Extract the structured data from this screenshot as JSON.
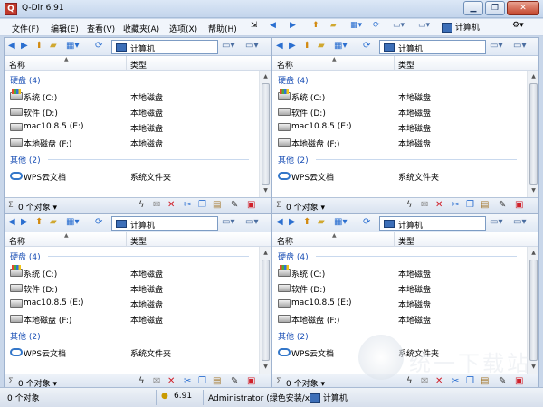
{
  "window": {
    "title": "Q-Dir 6.91",
    "controls": [
      "minimize",
      "restore",
      "close"
    ]
  },
  "menu": {
    "items": [
      "文件(F)",
      "编辑(E)",
      "查看(V)",
      "收藏夹(A)",
      "选项(X)",
      "帮助(H)"
    ],
    "right_label": "计算机"
  },
  "panes": [
    {
      "path": "计算机",
      "columns": {
        "name": "名称",
        "type": "类型"
      },
      "groups": [
        {
          "header": "硬盘 (4)",
          "items": [
            {
              "name": "系统 (C:)",
              "type": "本地磁盘",
              "icon": "system-drive-icon"
            },
            {
              "name": "软件 (D:)",
              "type": "本地磁盘",
              "icon": "drive-icon"
            },
            {
              "name": "mac10.8.5 (E:)",
              "type": "本地磁盘",
              "icon": "drive-icon"
            },
            {
              "name": "本地磁盘 (F:)",
              "type": "本地磁盘",
              "icon": "drive-icon"
            }
          ]
        },
        {
          "header": "其他 (2)",
          "items": [
            {
              "name": "WPS云文档",
              "type": "系统文件夹",
              "icon": "cloud-icon"
            }
          ]
        }
      ],
      "status": "0 个对象"
    },
    {
      "path": "计算机",
      "columns": {
        "name": "名称",
        "type": "类型"
      },
      "groups": [
        {
          "header": "硬盘 (4)",
          "items": [
            {
              "name": "系统 (C:)",
              "type": "本地磁盘",
              "icon": "system-drive-icon"
            },
            {
              "name": "软件 (D:)",
              "type": "本地磁盘",
              "icon": "drive-icon"
            },
            {
              "name": "mac10.8.5 (E:)",
              "type": "本地磁盘",
              "icon": "drive-icon"
            },
            {
              "name": "本地磁盘 (F:)",
              "type": "本地磁盘",
              "icon": "drive-icon"
            }
          ]
        },
        {
          "header": "其他 (2)",
          "items": [
            {
              "name": "WPS云文档",
              "type": "系统文件夹",
              "icon": "cloud-icon"
            }
          ]
        }
      ],
      "status": "0 个对象"
    },
    {
      "path": "计算机",
      "columns": {
        "name": "名称",
        "type": "类型"
      },
      "groups": [
        {
          "header": "硬盘 (4)",
          "items": [
            {
              "name": "系统 (C:)",
              "type": "本地磁盘",
              "icon": "system-drive-icon"
            },
            {
              "name": "软件 (D:)",
              "type": "本地磁盘",
              "icon": "drive-icon"
            },
            {
              "name": "mac10.8.5 (E:)",
              "type": "本地磁盘",
              "icon": "drive-icon"
            },
            {
              "name": "本地磁盘 (F:)",
              "type": "本地磁盘",
              "icon": "drive-icon"
            }
          ]
        },
        {
          "header": "其他 (2)",
          "items": [
            {
              "name": "WPS云文档",
              "type": "系统文件夹",
              "icon": "cloud-icon"
            }
          ]
        }
      ],
      "status": "0 个对象"
    },
    {
      "path": "计算机",
      "columns": {
        "name": "名称",
        "type": "类型"
      },
      "groups": [
        {
          "header": "硬盘 (4)",
          "items": [
            {
              "name": "系统 (C:)",
              "type": "本地磁盘",
              "icon": "system-drive-icon"
            },
            {
              "name": "软件 (D:)",
              "type": "本地磁盘",
              "icon": "drive-icon"
            },
            {
              "name": "mac10.8.5 (E:)",
              "type": "本地磁盘",
              "icon": "drive-icon"
            },
            {
              "name": "本地磁盘 (F:)",
              "type": "本地磁盘",
              "icon": "drive-icon"
            }
          ]
        },
        {
          "header": "其他 (2)",
          "items": [
            {
              "name": "WPS云文档",
              "type": "系统文件夹",
              "icon": "cloud-icon"
            }
          ]
        }
      ],
      "status": "0 个对象"
    }
  ],
  "statusbar": {
    "objects": "0 个对象",
    "version": "6.91",
    "user": "Administrator (绿色安装/x",
    "location": "计算机"
  },
  "watermark": {
    "text": "统一下载站"
  },
  "colors": {
    "accent": "#1a4fb5",
    "group_header": "#1a4fb5",
    "title_bg": "#c3d5ec",
    "close_button": "#c4452c"
  }
}
